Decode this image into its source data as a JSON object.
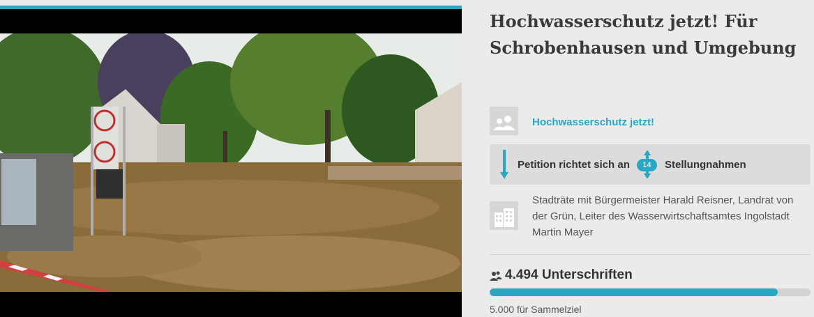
{
  "petition": {
    "title": "Hochwasserschutz jetzt! Für Schrobenhausen und Umgebung",
    "initiator": "Hochwasserschutz jetzt!",
    "addressed_label": "Petition richtet sich an",
    "statements_count": "14",
    "statements_label": "Stellungnahmen",
    "recipients": "Stadträte mit Bürgermeister Harald Reisner, Landrat von der Grün, Leiter des Wasserwirtschaftsamtes Ingolstadt Martin Mayer"
  },
  "signatures": {
    "count_label": "4.494 Unterschriften",
    "progress_fraction": 0.8988,
    "goal_label": "5.000 für Sammelziel"
  },
  "colors": {
    "accent": "#2aa7c2",
    "text": "#3a3a3a",
    "background": "#ebebeb"
  },
  "icons": {
    "initiator": "users-icon",
    "direction": "arrow-down-icon",
    "statements": "arrow-up-down-icon",
    "recipient": "building-icon",
    "signatures": "users-icon"
  }
}
